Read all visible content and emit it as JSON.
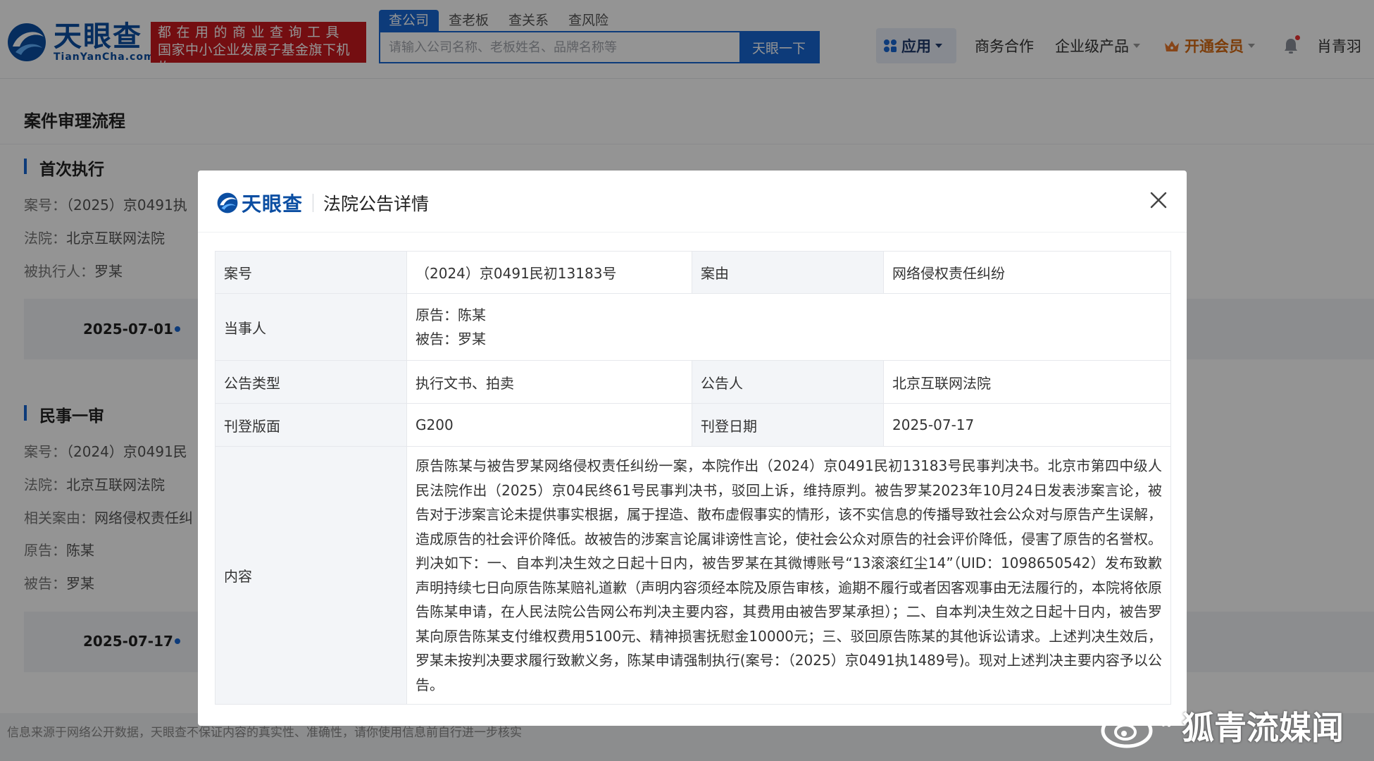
{
  "header": {
    "logo_cn": "天眼查",
    "logo_en": "TianYanCha.com",
    "slogan_line1": "都在用的商业查询工具",
    "slogan_line2": "国家中小企业发展子基金旗下机构",
    "search_tabs": [
      "查公司",
      "查老板",
      "查关系",
      "查风险"
    ],
    "search_placeholder": "请输入公司名称、老板姓名、品牌名称等",
    "search_button": "天眼一下",
    "nav": {
      "app": "应用",
      "business": "商务合作",
      "enterprise": "企业级产品",
      "vip": "开通会员",
      "user": "肖青羽"
    }
  },
  "page": {
    "section_title": "案件审理流程",
    "stage1": {
      "title": "首次执行",
      "case_label": "案号：",
      "case_value": "（2025）京0491执",
      "court_label": "法院：",
      "court_value": "北京互联网法院",
      "executed_label": "被执行人：",
      "executed_value": "罗某",
      "date": "2025-07-01"
    },
    "stage2": {
      "title": "民事一审",
      "case_label": "案号：",
      "case_value": "（2024）京0491民",
      "court_label": "法院：",
      "court_value": "北京互联网法院",
      "cause_label": "相关案由：",
      "cause_value": "网络侵权责任纠",
      "plaintiff_label": "原告：",
      "plaintiff_value": "陈某",
      "defendant_label": "被告：",
      "defendant_value": "罗某",
      "date": "2025-07-17"
    },
    "footer_note": "信息来源于网络公开数据，天眼查不保证内容的真实性、准确性，请你使用信息前自行进一步核实"
  },
  "modal": {
    "logo_cn": "天眼查",
    "title": "法院公告详情",
    "rows": {
      "case_no_label": "案号",
      "case_no_value": "（2024）京0491民初13183号",
      "cause_label": "案由",
      "cause_value": "网络侵权责任纠纷",
      "party_label": "当事人",
      "plaintiff": "原告：陈某",
      "defendant": "被告：罗某",
      "notice_type_label": "公告类型",
      "notice_type_value": "执行文书、拍卖",
      "announcer_label": "公告人",
      "announcer_value": "北京互联网法院",
      "page_label": "刊登版面",
      "page_value": "G200",
      "date_label": "刊登日期",
      "date_value": "2025-07-17",
      "content_label": "内容",
      "content_value": "原告陈某与被告罗某网络侵权责任纠纷一案，本院作出（2024）京0491民初13183号民事判决书。北京市第四中级人民法院作出（2025）京04民终61号民事判决书，驳回上诉，维持原判。被告罗某2023年10月24日发表涉案言论，被告对于涉案言论未提供事实根据，属于捏造、散布虚假事实的情形，该不实信息的传播导致社会公众对与原告产生误解，造成原告的社会评价降低。故被告的涉案言论属诽谤性言论，使社会公众对原告的社会评价降低，侵害了原告的名誉权。判决如下：一、自本判决生效之日起十日内，被告罗某在其微博账号“13滚滚红尘14”（UID：1098650542）发布致歉声明持续七日向原告陈某赔礼道歉（声明内容须经本院及原告审核，逾期不履行或者因客观事由无法履行的，本院将依原告陈某申请，在人民法院公告网公布判决主要内容，其费用由被告罗某承担）；二、自本判决生效之日起十日内，被告罗某向原告陈某支付维权费用5100元、精神损害抚慰金10000元；三、驳回原告陈某的其他诉讼请求。上述判决生效后，罗某未按判决要求履行致歉义务，陈某申请强制执行(案号：（2025）京0491执1489号)。现对上述判决主要内容予以公告。"
    }
  },
  "watermark": "狐青流媒闻",
  "colors": {
    "brand_blue": "#1867d2",
    "logo_blue": "#0b4ea2",
    "slogan_red": "#c8191e",
    "vip_orange": "#d66a12"
  },
  "icons": [
    "tianyancha-logo-icon",
    "app-grid-icon",
    "crown-icon",
    "bell-icon",
    "close-icon",
    "weibo-icon"
  ]
}
